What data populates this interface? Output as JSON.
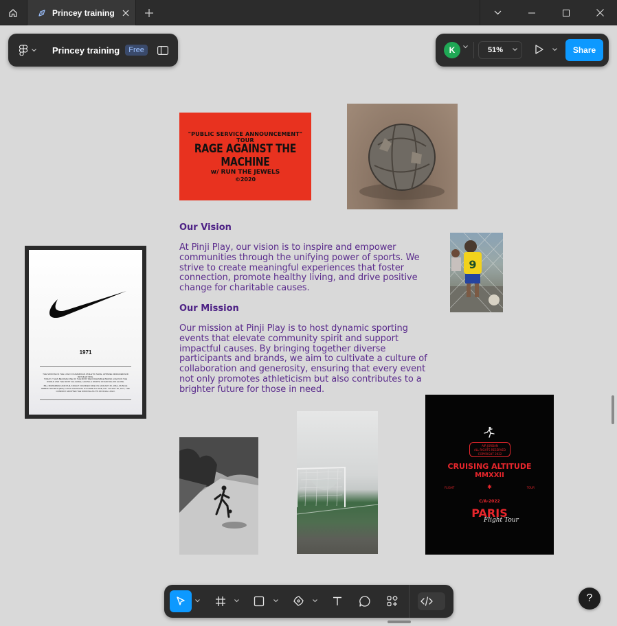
{
  "tab": {
    "title": "Princey training"
  },
  "file": {
    "name": "Princey training",
    "plan_badge": "Free"
  },
  "user": {
    "avatar_initial": "K",
    "avatar_color": "#1fa855"
  },
  "zoom": {
    "value": "51%"
  },
  "actions": {
    "share_label": "Share"
  },
  "canvas": {
    "red_poster": {
      "line1": "\"PUBLIC SERVICE ANNOUNCEMENT\" TOUR",
      "line2": "RAGE AGAINST THE MACHINE",
      "line3": "w/ RUN THE JEWELS",
      "line4": "©2020"
    },
    "nike_poster": {
      "year": "1971",
      "fine_print_1": "THE SWOOSH IS THE LOGO OF AMERICAN ATHLETIC SHOE, APPAREL DESIGNER AND RETAILER NIKE.",
      "fine_print_2": "TODAY, IT HAS BECOME ONE OF THE MOST RECOGNIZABLE BRAND LOGOS IN THE WORLD AND THE MOST VALUABLE, HAVING A WORTH OF $26 BILLION ALONE.",
      "fine_print_3": "BILL BOWERMAN AND PHIL KNIGHT FOUNDED NIKE ON JANUARY 25, 1964, AS BLUE RIBBON SPORTS (BRS). UPON CHANGING ITS NAME TO NIKE, INC. ON MAY 30, 1971, THE COMPANY ADOPTED THE SWOOSH AS ITS OFFICIAL LOGO."
    },
    "jordan_poster": {
      "box_line1": "AIR JORDAN",
      "box_line2": "ALL RIGHTS RESERVED",
      "box_line3": "COPYRIGHT 2022",
      "title1": "CRUISING ALTITUDE",
      "title2": "MMXXII",
      "left_label": "FLIGHT",
      "star": "✱",
      "right_label": "TOUR",
      "code": "C/A-2022",
      "city": "PARIS",
      "script": "Flight Tour",
      "accent_color": "#e8262c"
    },
    "text": {
      "vision_heading": "Our Vision",
      "vision_body": "At Pinji Play, our vision is to inspire and empower communities through the unifying power of sports. We strive to create meaningful experiences that foster connection, promote healthy living, and drive positive change for charitable causes.",
      "mission_heading": "Our Mission",
      "mission_body": "Our mission at Pinji Play is to host dynamic sporting events that elevate community spirit and support impactful causes. By bringing together diverse participants and brands, we aim to cultivate a culture of collaboration and generosity, ensuring that every event not only promotes athleticism but also contributes to a brighter future for those in need.",
      "text_color": "#5a2b8c"
    },
    "kid_jersey_number": "9"
  },
  "toolbar": {
    "tools": [
      "move-tool",
      "frame-tool",
      "shape-tool",
      "pen-tool",
      "text-tool",
      "comment-tool",
      "actions-tool",
      "dev-mode-toggle"
    ],
    "active_tool": "move-tool",
    "accent": "#0d99ff"
  },
  "help": {
    "label": "?"
  }
}
